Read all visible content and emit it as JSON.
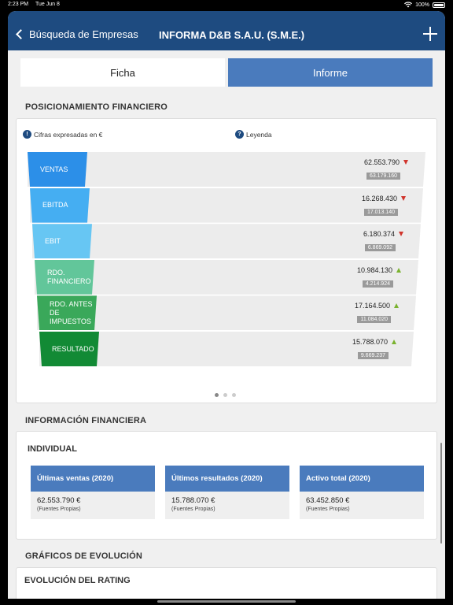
{
  "status": {
    "time": "2:23 PM",
    "date": "Tue Jun 8",
    "battery": "100%"
  },
  "nav": {
    "back_label": "Búsqueda de Empresas",
    "title": "INFORMA D&B S.A.U. (S.M.E.)"
  },
  "tabs": [
    {
      "label": "Ficha",
      "active": false
    },
    {
      "label": "Informe",
      "active": true
    }
  ],
  "posicionamiento": {
    "title": "POSICIONAMIENTO FINANCIERO",
    "currency_note": "Cifras expresadas en  €",
    "legend_label": "Leyenda",
    "rows": [
      {
        "label": "VENTAS",
        "value": "62.553.790",
        "trend": "down",
        "previous": "63.179.160",
        "color": "#2c8fe8"
      },
      {
        "label": "EBITDA",
        "value": "16.268.430",
        "trend": "down",
        "previous": "17.013.140",
        "color": "#45aef2"
      },
      {
        "label": "EBIT",
        "value": "6.180.374",
        "trend": "down",
        "previous": "6.869.092",
        "color": "#67c6f3"
      },
      {
        "label": "RDO. FINANCIERO",
        "value": "10.984.130",
        "trend": "up",
        "previous": "4.214.924",
        "color": "#62c69a"
      },
      {
        "label": "RDO. ANTES DE IMPUESTOS",
        "value": "17.164.500",
        "trend": "up",
        "previous": "11.084.020",
        "color": "#3aa85a"
      },
      {
        "label": "RESULTADO",
        "value": "15.788.070",
        "trend": "up",
        "previous": "9.669.237",
        "color": "#128a35"
      }
    ]
  },
  "informacion": {
    "title": "INFORMACIÓN FINANCIERA",
    "subtitle": "INDIVIDUAL",
    "boxes": [
      {
        "head": "Últimas ventas (2020)",
        "value": "62.553.790 €",
        "source": "(Fuentes Propias)"
      },
      {
        "head": "Últimos resultados (2020)",
        "value": "15.788.070 €",
        "source": "(Fuentes Propias)"
      },
      {
        "head": "Activo total (2020)",
        "value": "63.452.850 €",
        "source": "(Fuentes Propias)"
      }
    ]
  },
  "graficos": {
    "title": "GRÁFICOS DE EVOLUCIÓN",
    "rating_title": "EVOLUCIÓN DEL RATING"
  }
}
